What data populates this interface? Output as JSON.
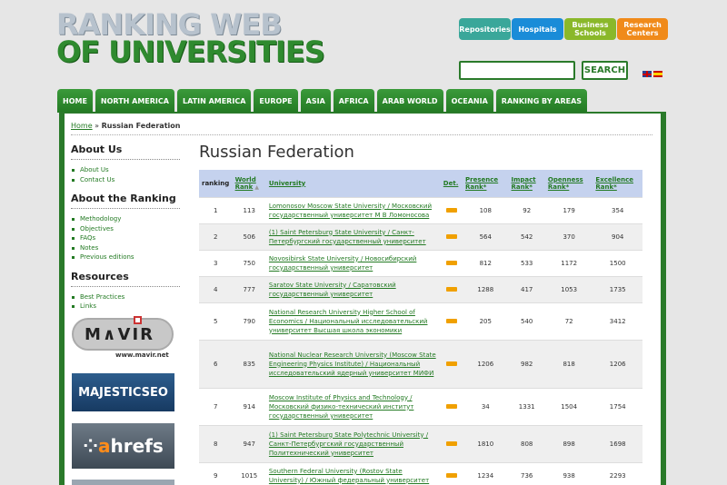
{
  "logo": {
    "line1": "RANKING WEB",
    "line2": "OF UNIVERSITIES"
  },
  "quick_links": [
    {
      "label": "Repositories",
      "color": "#3aa79a"
    },
    {
      "label": "Hospitals",
      "color": "#1a8cd8"
    },
    {
      "label": "Business Schools",
      "color": "#8ab82a"
    },
    {
      "label": "Research Centers",
      "color": "#f08a1a"
    }
  ],
  "search": {
    "value": "",
    "button": "SEARCH"
  },
  "languages": [
    "english-flag",
    "spanish-flag"
  ],
  "nav": [
    "HOME",
    "NORTH AMERICA",
    "LATIN AMERICA",
    "EUROPE",
    "ASIA",
    "AFRICA",
    "ARAB WORLD",
    "OCEANIA",
    "RANKING BY AREAS"
  ],
  "breadcrumb": {
    "home": "Home",
    "sep": "»",
    "current": "Russian Federation"
  },
  "sidebar": {
    "sections": [
      {
        "title": "About Us",
        "items": [
          "About Us",
          "Contact Us"
        ]
      },
      {
        "title": "About the Ranking",
        "items": [
          "Methodology",
          "Objectives",
          "FAQs",
          "Notes",
          "Previous editions"
        ]
      },
      {
        "title": "Resources",
        "items": [
          "Best Practices",
          "Links"
        ]
      }
    ],
    "banners": {
      "mavir_word": "M∧VIR",
      "mavir_url": "www.mavir.net",
      "majestic": "MAJESTICSEO",
      "ahrefs_prefix": "⁘ ",
      "ahrefs_a": "a",
      "ahrefs_rest": "hrefs"
    }
  },
  "page_title": "Russian Federation",
  "table": {
    "headers": {
      "ranking": "ranking",
      "world_rank": "World Rank",
      "university": "University",
      "det": "Det.",
      "presence": "Presence Rank*",
      "impact": "Impact Rank*",
      "openness": "Openness Rank*",
      "excellence": "Excellence Rank*"
    },
    "rows": [
      {
        "ranking": "1",
        "world": "113",
        "name": "Lomonosov Moscow State University / Московский государственный университет М В Ломоносова",
        "presence": "108",
        "impact": "92",
        "openness": "179",
        "excellence": "354"
      },
      {
        "ranking": "2",
        "world": "506",
        "name": "(1) Saint Petersburg State University / Санкт-Петербургский государственный университет",
        "presence": "564",
        "impact": "542",
        "openness": "370",
        "excellence": "904"
      },
      {
        "ranking": "3",
        "world": "750",
        "name": "Novosibirsk State University / Новосибирский государственный университет",
        "presence": "812",
        "impact": "533",
        "openness": "1172",
        "excellence": "1500"
      },
      {
        "ranking": "4",
        "world": "777",
        "name": "Saratov State University / Саратовский государственный университет",
        "presence": "1288",
        "impact": "417",
        "openness": "1053",
        "excellence": "1735"
      },
      {
        "ranking": "5",
        "world": "790",
        "name": "National Research University Higher School of Economics / Национальный исследовательский университет Высшая школа экономики",
        "presence": "205",
        "impact": "540",
        "openness": "72",
        "excellence": "3412"
      },
      {
        "ranking": "6",
        "world": "835",
        "name": "National Nuclear Research University (Moscow State Engineering Physics Institute) / Национальный исследовательский ядерный университет МИФИ",
        "presence": "1206",
        "impact": "982",
        "openness": "818",
        "excellence": "1206"
      },
      {
        "ranking": "7",
        "world": "914",
        "name": "Moscow Institute of Physics and Technology / Московский физико-технический институт государственный университет",
        "presence": "34",
        "impact": "1331",
        "openness": "1504",
        "excellence": "1754"
      },
      {
        "ranking": "8",
        "world": "947",
        "name": "(1) Saint Petersburg State Polytechnic University / Санкт-Петербургский государственный Политехнический университет",
        "presence": "1810",
        "impact": "808",
        "openness": "898",
        "excellence": "1698"
      },
      {
        "ranking": "9",
        "world": "1015",
        "name": "Southern Federal University (Rostov State University) / Южный федеральный университет",
        "presence": "1234",
        "impact": "736",
        "openness": "938",
        "excellence": "2293"
      }
    ]
  }
}
